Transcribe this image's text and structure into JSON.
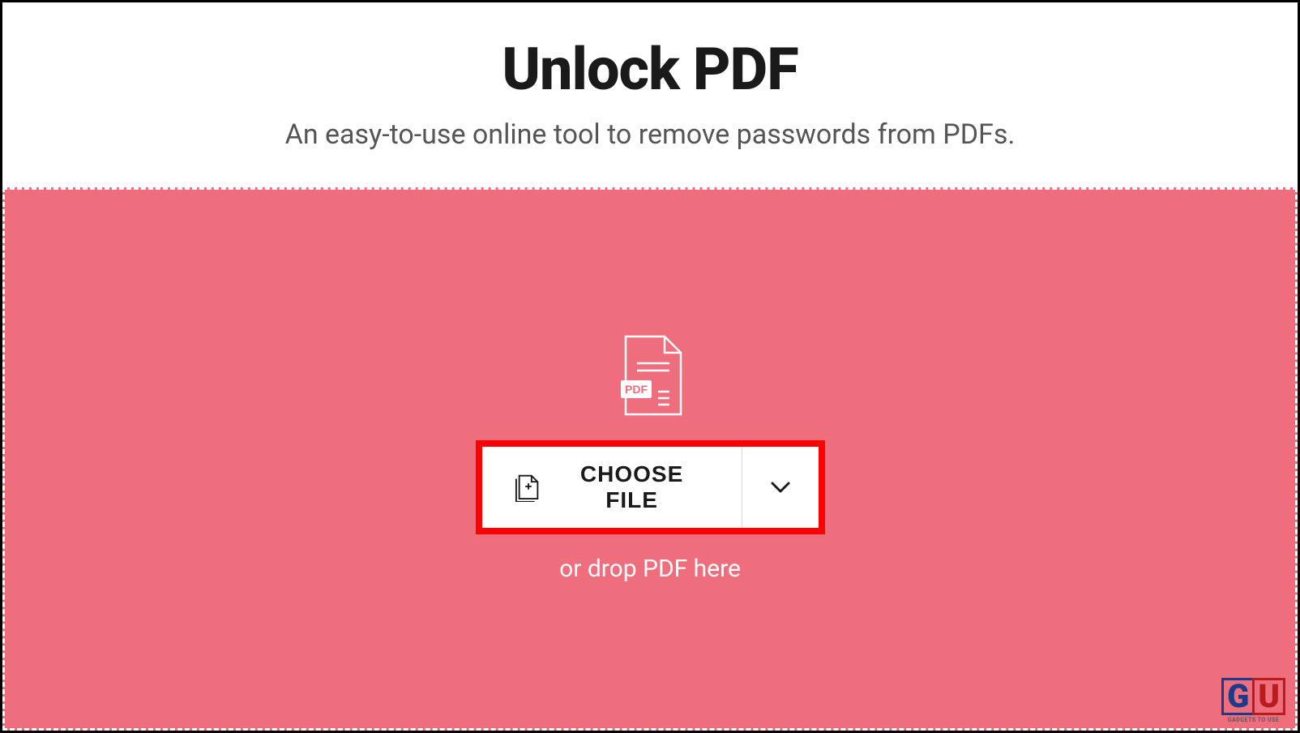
{
  "header": {
    "title": "Unlock PDF",
    "subtitle": "An easy-to-use online tool to remove passwords from PDFs."
  },
  "dropzone": {
    "pdf_badge": "PDF",
    "choose_file_label": "CHOOSE FILE",
    "drop_text": "or drop PDF here"
  },
  "watermark": {
    "g": "G",
    "u": "U",
    "text": "GADGETS TO USE"
  },
  "colors": {
    "dropzone_bg": "#ee6e7e",
    "highlight_border": "#ff0000",
    "text_dark": "#1a1a1a",
    "text_white": "#ffffff"
  }
}
